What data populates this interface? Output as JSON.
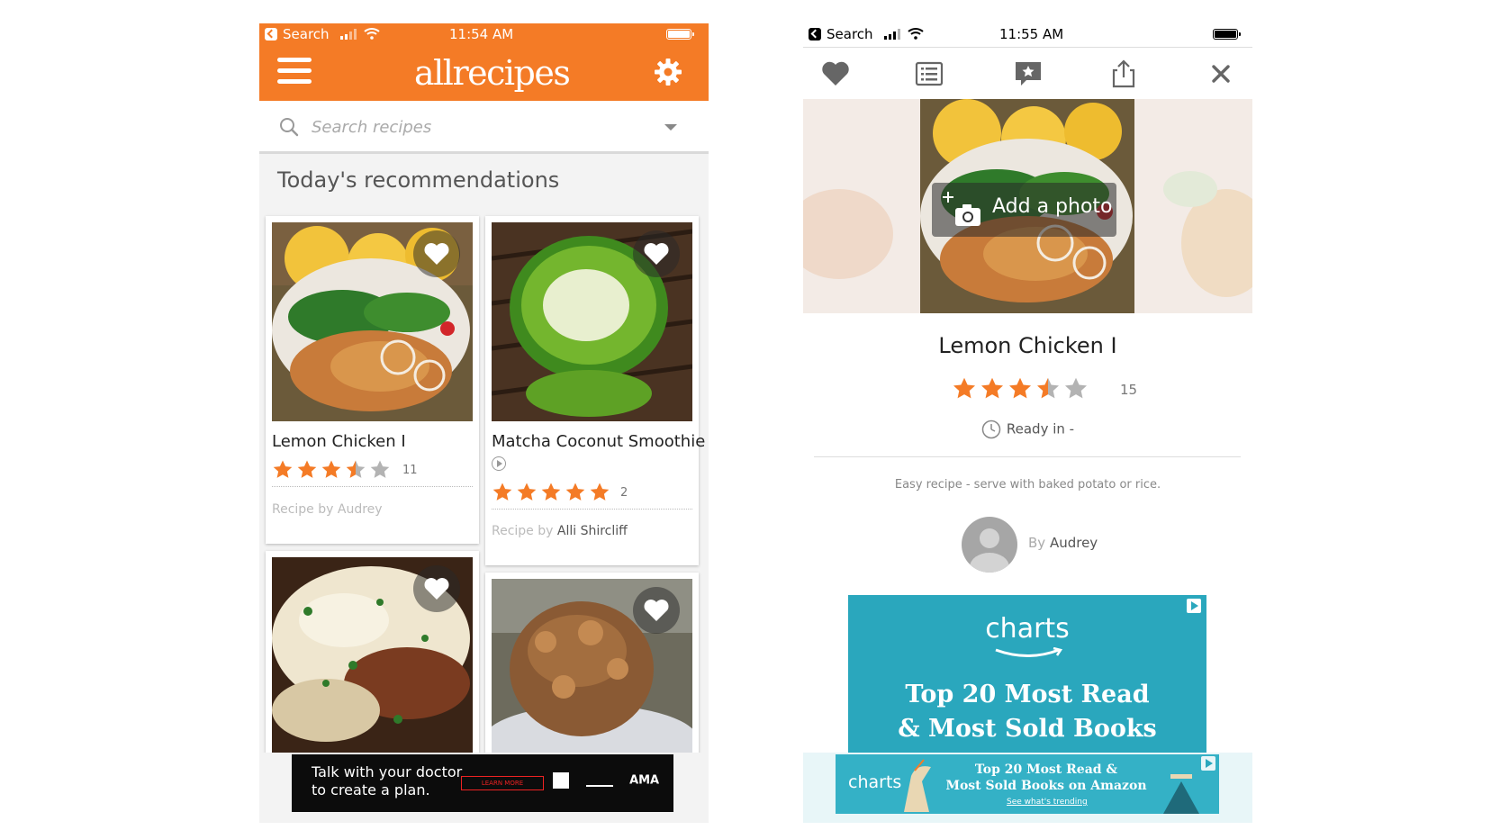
{
  "left": {
    "status": {
      "back_label": "Search",
      "time": "11:54 AM"
    },
    "app_logo": "allrecipes",
    "search": {
      "placeholder": "Search recipes"
    },
    "section_title": "Today's recommendations",
    "cards": [
      {
        "name": "Lemon Chicken I",
        "rating": 3.5,
        "review_count": "11",
        "byline_prefix": "Recipe by",
        "author": "Audrey",
        "has_video": false
      },
      {
        "name": "Matcha Coconut Smoothie",
        "rating": 5,
        "review_count": "2",
        "byline_prefix": "Recipe by",
        "author": "Alli Shircliff",
        "has_video": true
      },
      {
        "name": "",
        "rating": null
      },
      {
        "name": "",
        "rating": null
      }
    ],
    "ad": {
      "text_line1": "Talk with your doctor",
      "text_line2": "to create a plan.",
      "button": "LEARN MORE",
      "logos": "AMA"
    }
  },
  "right": {
    "status": {
      "back_label": "Search",
      "time": "11:55 AM"
    },
    "toolbar": [
      "heart-icon",
      "list-icon",
      "review-icon",
      "share-icon",
      "close-icon"
    ],
    "add_photo_label": "Add a photo",
    "recipe_title": "Lemon Chicken I",
    "rating": 3.5,
    "review_count": "15",
    "ready_in": "Ready in -",
    "description": "Easy recipe - serve with baked potato or rice.",
    "by_prefix": "By",
    "author": "Audrey",
    "ad_big": {
      "brand": "charts",
      "headline_line1": "Top 20 Most Read",
      "headline_line2": "& Most Sold Books"
    },
    "ad_small": {
      "brand": "charts",
      "headline_line1": "Top 20 Most Read &",
      "headline_line2": "Most Sold Books on Amazon",
      "link": "See what's trending"
    }
  },
  "colors": {
    "accent": "#f47b26",
    "star_gray": "#b3b3b3",
    "ad_teal": "#2aa7bd"
  }
}
